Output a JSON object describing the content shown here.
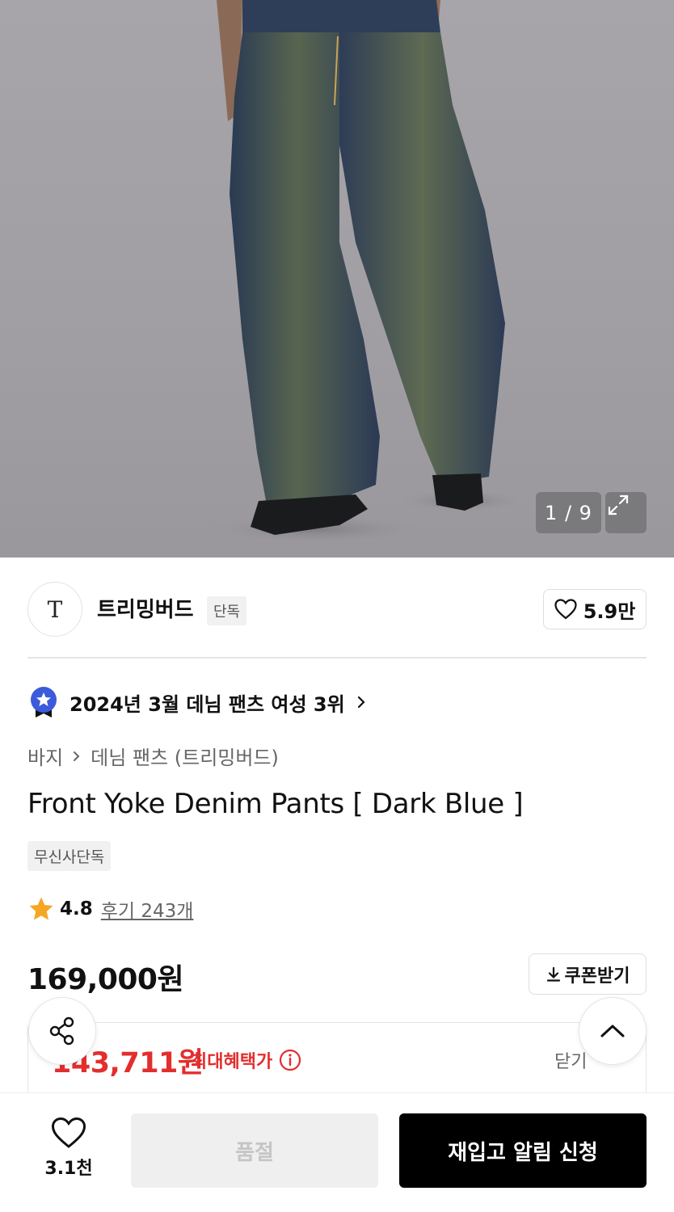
{
  "gallery": {
    "counter": "1 / 9"
  },
  "brand": {
    "logo_letter": "T",
    "name": "트리밍버드",
    "badge": "단독",
    "likes": "5.9만"
  },
  "ranking": {
    "text": "2024년 3월 데님 팬츠 여성 3위"
  },
  "breadcrumb": {
    "items": [
      "바지",
      "데님 팬츠 (트리밍버드)"
    ]
  },
  "product": {
    "title": "Front Yoke Denim Pants [ Dark Blue ]",
    "exclusive_badge": "무신사단독",
    "rating": "4.8",
    "reviews_label": "후기 243개",
    "price": "169,000원",
    "coupon_label": "쿠폰받기",
    "benefit_price": "143,711원",
    "benefit_label": "최대혜택가",
    "close_label": "닫기"
  },
  "bottom_bar": {
    "wish_count": "3.1천",
    "soldout_label": "품절",
    "restock_label": "재입고 알림 신청"
  },
  "colors": {
    "accent_red": "#e32e2e",
    "star": "#f5a623",
    "rank_badge": "#3b5bdb"
  }
}
